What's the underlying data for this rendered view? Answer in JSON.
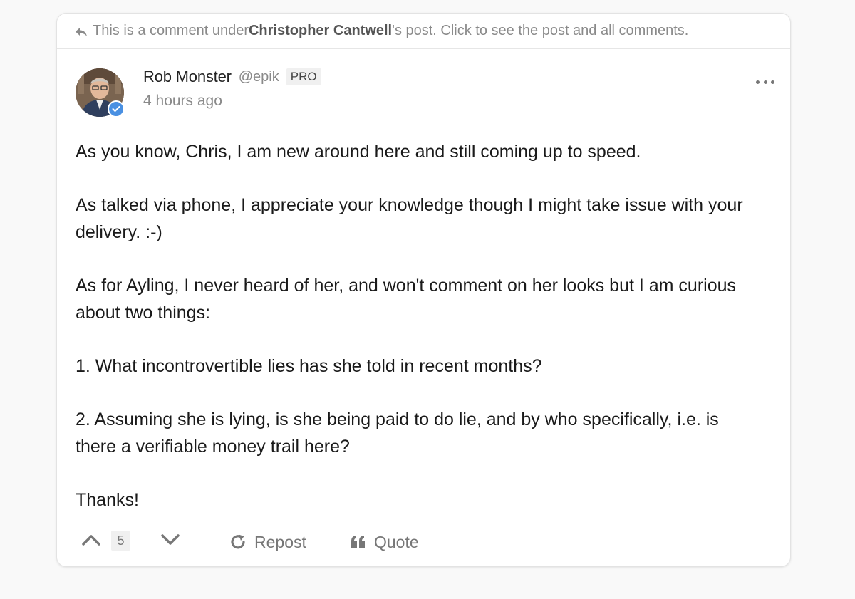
{
  "context": {
    "prefix": "This is a comment under ",
    "author": "Christopher Cantwell",
    "suffix": "'s post. Click to see the post and all comments."
  },
  "comment": {
    "display_name": "Rob Monster",
    "handle": "@epik",
    "badge": "PRO",
    "timestamp": "4 hours ago",
    "paragraphs": [
      "As you know, Chris, I am new around here and still coming up to speed.",
      "As talked via phone, I appreciate your knowledge though I might take issue with your delivery. :-)",
      "As for Ayling, I never heard of her, and won't comment on her looks but I am curious about two things:",
      "1. What incontrovertible lies has she told in recent months?",
      "2. Assuming she is lying, is she being paid to do lie, and by who specifically, i.e. is there a verifiable money trail here?",
      "Thanks!"
    ]
  },
  "actions": {
    "score": "5",
    "repost_label": "Repost",
    "quote_label": "Quote"
  },
  "icons": {
    "reply": "reply-arrow-icon",
    "verified": "verified-check-icon",
    "more": "more-dots-icon",
    "upvote": "chevron-up-icon",
    "downvote": "chevron-down-icon",
    "repost": "repost-icon",
    "quote": "quote-icon"
  },
  "colors": {
    "verified_badge": "#4a90e2",
    "muted_text": "#8a8a8a"
  }
}
